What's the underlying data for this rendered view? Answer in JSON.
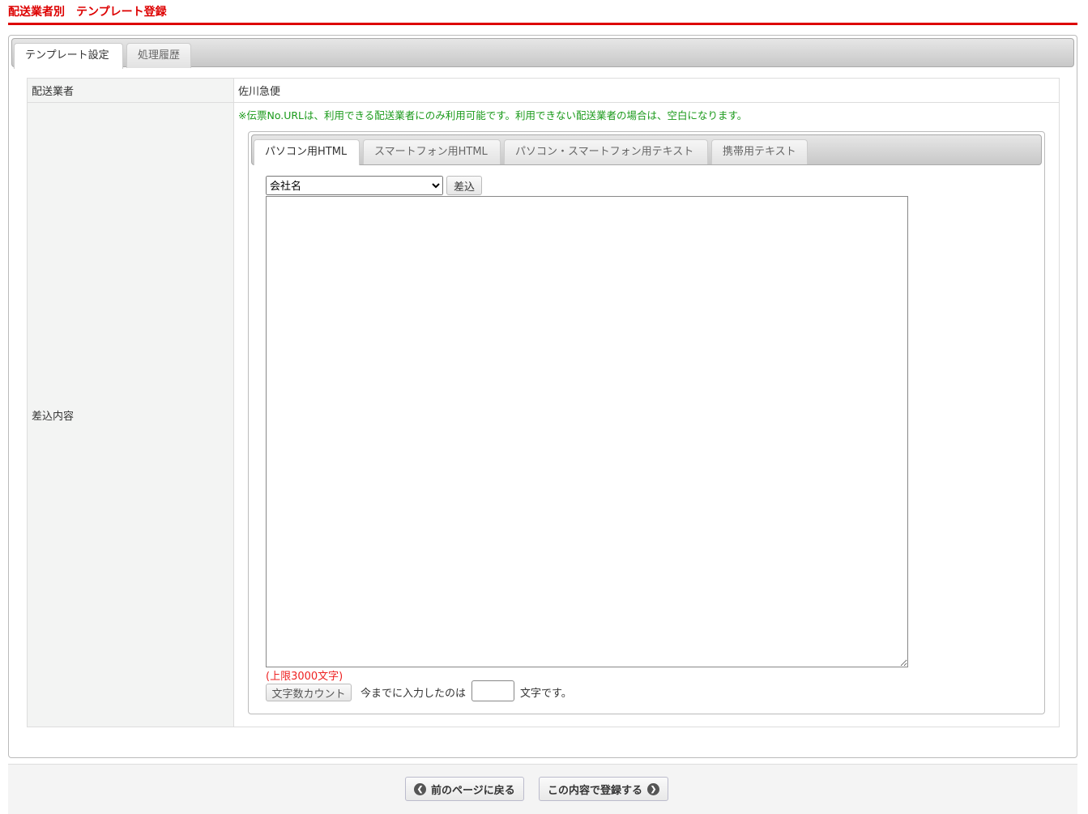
{
  "header": {
    "title": "配送業者別　テンプレート登録"
  },
  "tabs": [
    {
      "label": "テンプレート設定"
    },
    {
      "label": "処理履歴"
    }
  ],
  "form": {
    "carrier_label": "配送業者",
    "carrier_value": "佐川急便",
    "content_label": "差込内容",
    "note": "※伝票No.URLは、利用できる配送業者にのみ利用可能です。利用できない配送業者の場合は、空白になります。",
    "inner_tabs": [
      {
        "label": "パソコン用HTML"
      },
      {
        "label": "スマートフォン用HTML"
      },
      {
        "label": "パソコン・スマートフォン用テキスト"
      },
      {
        "label": "携帯用テキスト"
      }
    ],
    "select_value": "会社名",
    "insert_button": "差込",
    "textarea_value": "",
    "limit": "(上限3000文字)",
    "count_button": "文字数カウント",
    "count_prefix": "今までに入力したのは",
    "count_value": "",
    "count_suffix": "文字です。"
  },
  "footer": {
    "back": "前のページに戻る",
    "submit": "この内容で登録する"
  }
}
